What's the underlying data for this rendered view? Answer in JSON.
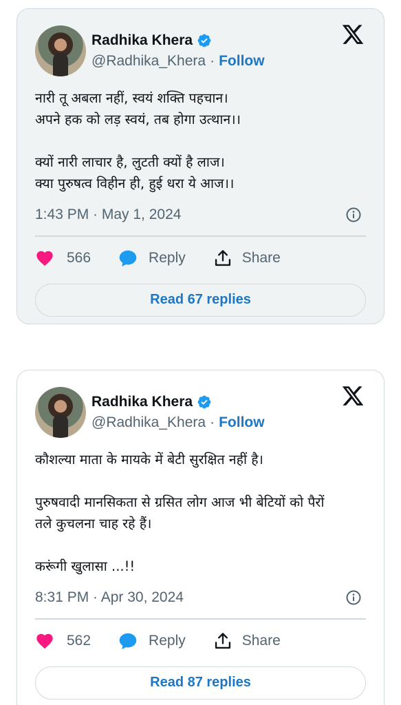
{
  "tweets": [
    {
      "author": {
        "name": "Radhika Khera",
        "handle": "@Radhika_Khera",
        "follow_label": "Follow"
      },
      "paragraphs": [
        "नारी तू अबला नहीं, स्वयं शक्ति पहचान।\nअपने हक को लड़ स्वयं, तब होगा उत्थान।।",
        "क्यों नारी लाचार है, लुटती क्यों है लाज।\nक्या पुरुषत्व विहीन ही, हुई धरा ये आज।।"
      ],
      "timestamp": "1:43 PM · May 1, 2024",
      "likes": "566",
      "reply_label": "Reply",
      "share_label": "Share",
      "read_replies_label": "Read 67 replies"
    },
    {
      "author": {
        "name": "Radhika Khera",
        "handle": "@Radhika_Khera",
        "follow_label": "Follow"
      },
      "paragraphs": [
        "कौशल्या माता के मायके में बेटी सुरक्षित नहीं है।",
        "पुरुषवादी मानसिकता से ग्रसित लोग आज भी बेटियों को पैरों\nतले कुचलना चाह रहे हैं।",
        "करूंगी खुलासा ...!!"
      ],
      "timestamp": "8:31 PM · Apr 30, 2024",
      "likes": "562",
      "reply_label": "Reply",
      "share_label": "Share",
      "read_replies_label": "Read 87 replies"
    }
  ],
  "icons": {
    "verified": "verified-badge-icon",
    "platform": "x-logo-icon",
    "info": "info-icon",
    "like": "heart-icon",
    "reply": "speech-bubble-icon",
    "share": "share-upload-icon"
  },
  "colors": {
    "accent": "#1d77c4",
    "heart": "#f91880",
    "reply_bubble": "#1d9bf0",
    "muted_text": "#536471",
    "card_bg_first": "#eff3f4",
    "border": "#cfd9de"
  }
}
